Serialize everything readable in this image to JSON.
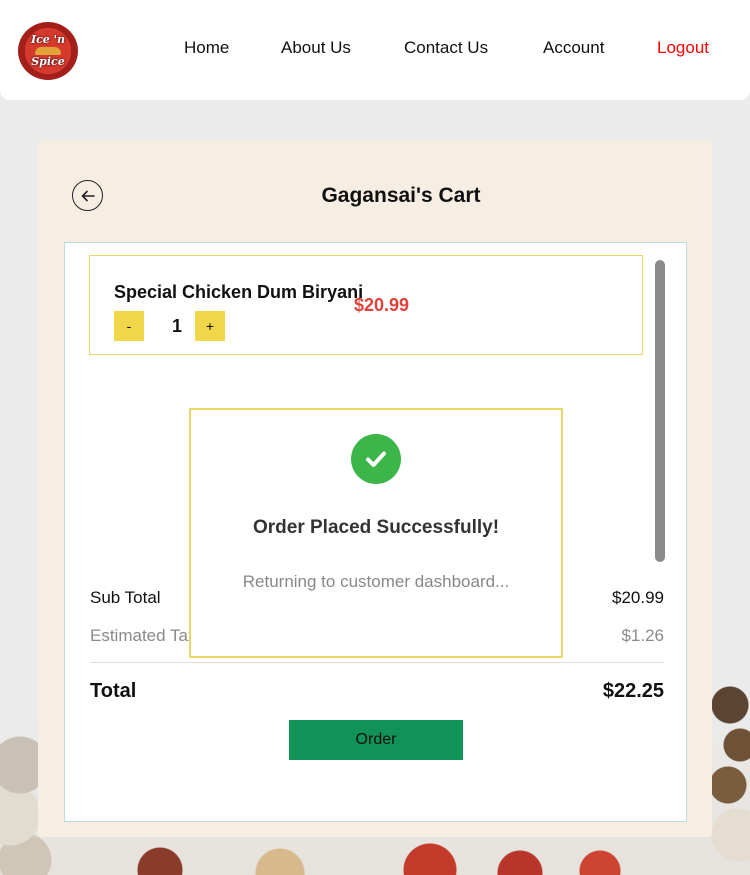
{
  "header": {
    "logo_text_top": "Ice 'n",
    "logo_text_bottom": "Spice",
    "nav": {
      "home": "Home",
      "about": "About Us",
      "contact": "Contact Us",
      "account": "Account",
      "logout": "Logout"
    },
    "logout_color": "#ff0000"
  },
  "cart": {
    "title": "Gagansai's Cart",
    "back_icon": "arrow-left-circle-icon",
    "items": [
      {
        "name": "Special Chicken Dum Biryani",
        "price": "$20.99",
        "quantity": "1",
        "minus_label": "-",
        "plus_label": "+"
      }
    ],
    "summary": {
      "subtotal_label": "Sub Total",
      "subtotal_value": "$20.99",
      "tax_label": "Estimated Tax",
      "tax_value": "$1.26",
      "total_label": "Total",
      "total_value": "$22.25"
    },
    "order_button": "Order",
    "colors": {
      "price": "#e0413a",
      "qty_button": "#f1d649",
      "order_button": "#119257",
      "card_bg": "#f7eee3"
    }
  },
  "modal": {
    "icon": "check-circle-icon",
    "title": "Order Placed Successfully!",
    "message": "Returning to customer dashboard...",
    "icon_color": "#3cb649"
  }
}
